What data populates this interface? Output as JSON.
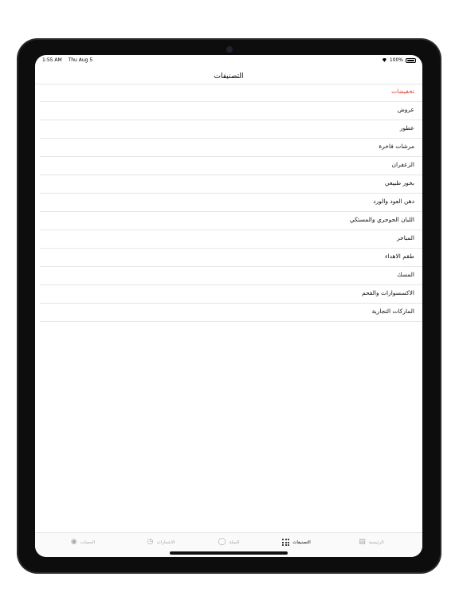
{
  "status": {
    "time": "1:55 AM",
    "date": "Thu Aug 5",
    "battery": "100%"
  },
  "nav": {
    "title": "التصنيفات"
  },
  "categories": [
    {
      "label": "تخفيضات",
      "accent": "#e03a2f"
    },
    {
      "label": "عروض"
    },
    {
      "label": "عطور"
    },
    {
      "label": "مرشات فاخرة"
    },
    {
      "label": "الزعفران"
    },
    {
      "label": "بخور طبيعي"
    },
    {
      "label": "دهن العود والورد"
    },
    {
      "label": "اللبان الحوجري والمستكي"
    },
    {
      "label": "المباخر"
    },
    {
      "label": "طقم الاهداء"
    },
    {
      "label": "المسك"
    },
    {
      "label": "الاكسسوارات والفحم"
    },
    {
      "label": "الماركات التجارية"
    }
  ],
  "tabs": [
    {
      "label": "الرئيسية",
      "icon": "home-card-icon"
    },
    {
      "label": "التصنيفات",
      "icon": "grid-dots-icon",
      "active": true
    },
    {
      "label": "السلة",
      "icon": "cart-icon"
    },
    {
      "label": "الاشعارات",
      "icon": "bell-icon"
    },
    {
      "label": "الحساب",
      "icon": "camera-icon"
    }
  ]
}
